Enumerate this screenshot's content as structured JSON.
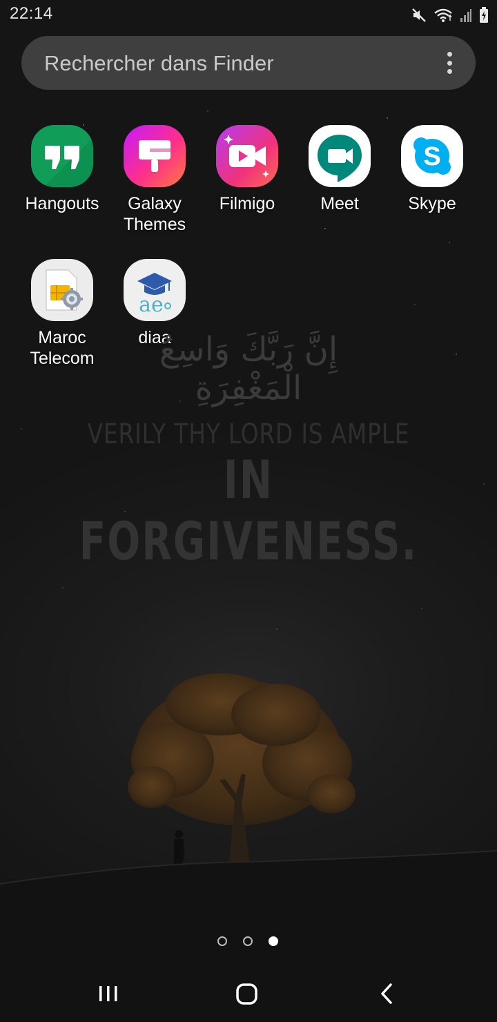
{
  "status_bar": {
    "time": "22:14",
    "icons": [
      "mute-icon",
      "wifi-icon",
      "signal-icon",
      "battery-icon"
    ]
  },
  "search": {
    "placeholder": "Rechercher dans Finder",
    "more_icon": "more-vertical-icon"
  },
  "apps": [
    {
      "id": "hangouts",
      "label": "Hangouts",
      "icon": "hangouts-icon",
      "color": "#0F9D58"
    },
    {
      "id": "galaxy-themes",
      "label": "Galaxy Themes",
      "icon": "galaxy-themes-icon",
      "color": "#E040FB"
    },
    {
      "id": "filmigo",
      "label": "Filmigo",
      "icon": "filmigo-icon",
      "color": "#E4347A"
    },
    {
      "id": "meet",
      "label": "Meet",
      "icon": "meet-icon",
      "color": "#00897B"
    },
    {
      "id": "skype",
      "label": "Skype",
      "icon": "skype-icon",
      "color": "#00AFF0"
    },
    {
      "id": "maroc-telecom",
      "label": "Maroc Telecom",
      "icon": "sim-settings-icon",
      "color": "#F5B400"
    },
    {
      "id": "diaa",
      "label": "diaa",
      "icon": "graduation-cap-icon",
      "color": "#2E5AAC"
    }
  ],
  "wallpaper": {
    "arabic": "إِنَّ رَبَّكَ وَاسِعُ الْمَغْفِرَةِ",
    "line1": "VERILY THY LORD IS AMPLE",
    "line2": "IN FORGIVENESS."
  },
  "page_indicator": {
    "total": 3,
    "active": 3
  },
  "nav_bar": {
    "recents_icon": "recents-icon",
    "home_icon": "home-icon",
    "back_icon": "back-icon"
  }
}
